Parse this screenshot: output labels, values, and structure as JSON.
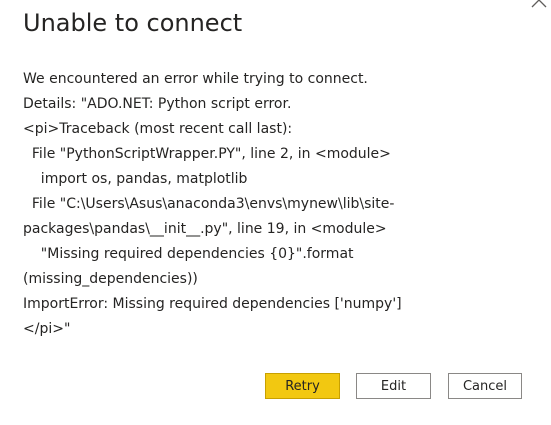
{
  "dialog": {
    "title": "Unable to connect",
    "message_lines": [
      "We encountered an error while trying to connect.",
      "Details: \"ADO.NET: Python script error.",
      "<pi>Traceback (most recent call last):",
      "  File \"PythonScriptWrapper.PY\", line 2, in <module>",
      "    import os, pandas, matplotlib",
      "  File \"C:\\Users\\Asus\\anaconda3\\envs\\mynew\\lib\\site-",
      "packages\\pandas\\__init__.py\", line 19, in <module>",
      "    \"Missing required dependencies {0}\".format",
      "(missing_dependencies))",
      "ImportError: Missing required dependencies ['numpy']",
      "</pi>\""
    ],
    "buttons": {
      "retry": "Retry",
      "edit": "Edit",
      "cancel": "Cancel"
    },
    "close_icon": "close-icon",
    "colors": {
      "primary_button": "#f2c811",
      "text": "#252423"
    }
  }
}
